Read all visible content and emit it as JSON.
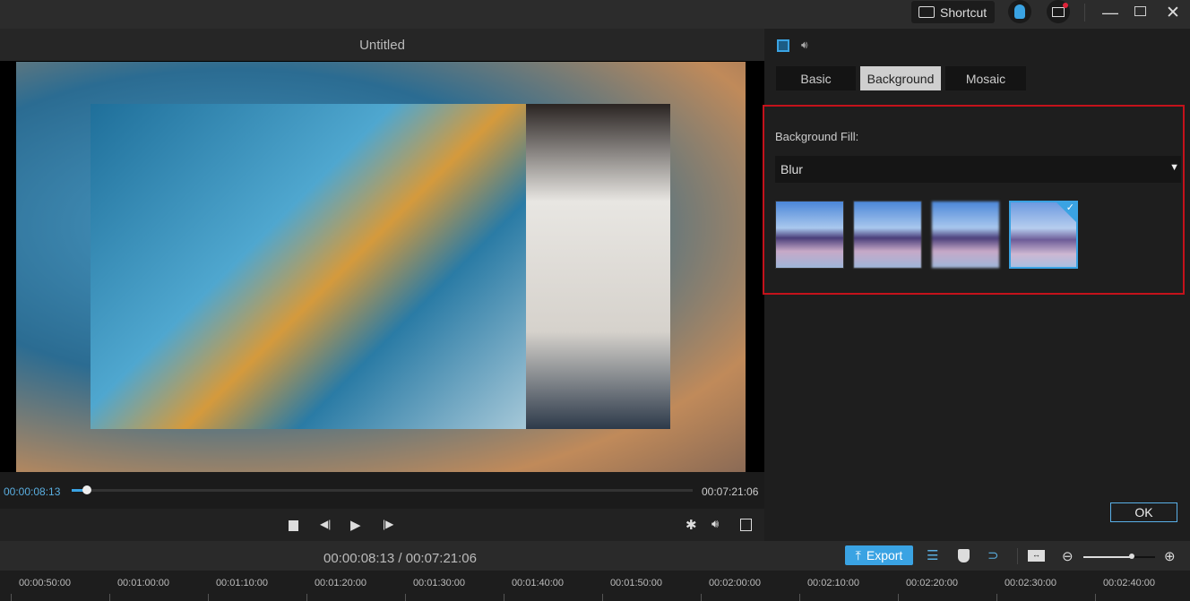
{
  "titlebar": {
    "shortcut_label": "Shortcut",
    "icons": [
      "keyboard-icon",
      "user-icon",
      "mail-icon",
      "minimize-icon",
      "restore-icon",
      "close-icon"
    ]
  },
  "preview": {
    "title": "Untitled",
    "current_time": "00:00:08:13",
    "total_time": "00:07:21:06",
    "progress_percent": 2
  },
  "right_panel": {
    "tabs": [
      {
        "label": "Basic"
      },
      {
        "label": "Background"
      },
      {
        "label": "Mosaic"
      }
    ],
    "active_tab": "Background",
    "fill_label": "Background Fill:",
    "fill_value": "Blur",
    "selected_thumbnail": 4,
    "ok_label": "OK"
  },
  "bottom": {
    "timecode": "00:00:08:13 / 00:07:21:06",
    "export_label": "Export",
    "accent": "#3aa3e3"
  },
  "timeline": {
    "ticks": [
      "00:00:50:00",
      "00:01:00:00",
      "00:01:10:00",
      "00:01:20:00",
      "00:01:30:00",
      "00:01:40:00",
      "00:01:50:00",
      "00:02:00:00",
      "00:02:10:00",
      "00:02:20:00",
      "00:02:30:00",
      "00:02:40:00"
    ]
  },
  "colors": {
    "highlight": "#c4121b",
    "accent": "#3aa3e3"
  }
}
